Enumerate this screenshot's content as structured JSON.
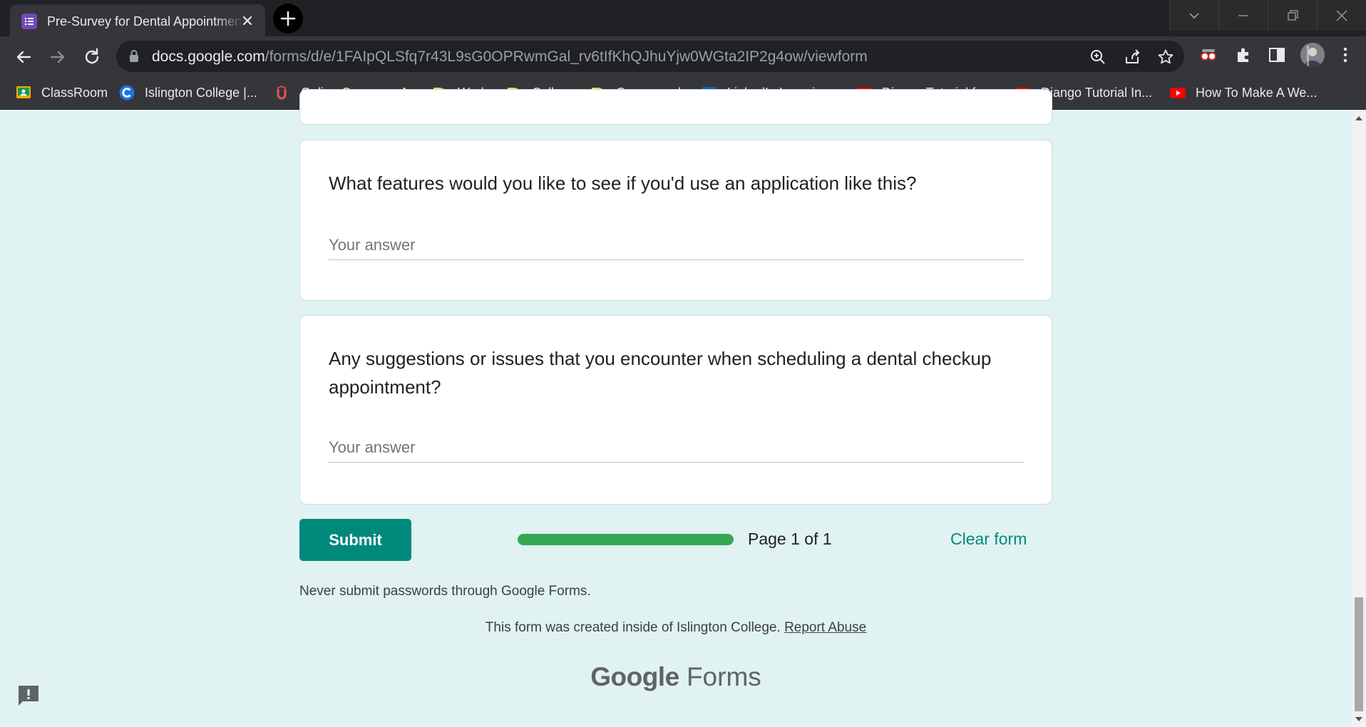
{
  "browser": {
    "tab_title": "Pre-Survey for Dental Appointment",
    "url_host": "docs.google.com",
    "url_path": "/forms/d/e/1FAIpQLSfq7r43L9sG0OPRwmGal_rv6tIfKhQJhuYjw0WGta2IP2g4ow/viewform",
    "bookmarks": [
      {
        "label": "ClassRoom",
        "icon": "classroom-icon"
      },
      {
        "label": "Islington College |...",
        "icon": "islington-icon"
      },
      {
        "label": "Online Courses - A...",
        "icon": "udemy-icon"
      },
      {
        "label": "Work",
        "icon": "folder-icon"
      },
      {
        "label": "College",
        "icon": "folder-icon"
      },
      {
        "label": "Coursework",
        "icon": "folder-icon"
      },
      {
        "label": "LinkedIn Learning:...",
        "icon": "linkedin-learning-icon"
      },
      {
        "label": "Django Tutorial for...",
        "icon": "youtube-icon"
      },
      {
        "label": "Django Tutorial In...",
        "icon": "youtube-icon"
      },
      {
        "label": "How To Make A We...",
        "icon": "youtube-icon"
      }
    ]
  },
  "form": {
    "questions": [
      {
        "text": "What features would you like to see if you'd use an application like this?",
        "placeholder": "Your answer"
      },
      {
        "text": "Any suggestions or issues that you encounter when scheduling a dental checkup appointment?",
        "placeholder": "Your answer"
      }
    ],
    "submit_label": "Submit",
    "progress_fraction": 1.0,
    "page_label": "Page 1 of 1",
    "clear_label": "Clear form",
    "password_note": "Never submit passwords through Google Forms.",
    "footer_text": "This form was created inside of Islington College.",
    "report_label": "Report Abuse",
    "brand_google": "Google",
    "brand_forms": "Forms"
  },
  "colors": {
    "accent": "#00897b",
    "page_background": "#e0f2f1",
    "progress": "#34a853"
  }
}
